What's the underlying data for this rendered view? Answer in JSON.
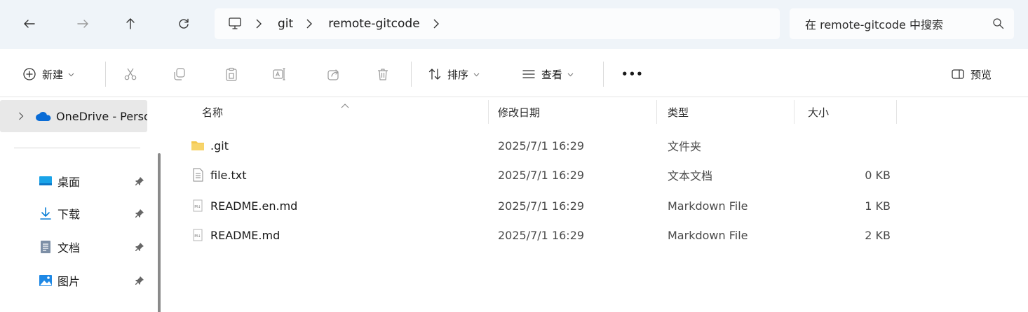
{
  "nav": {
    "back_icon": "arrow-left-icon",
    "forward_icon": "arrow-right-icon",
    "up_icon": "arrow-up-icon",
    "refresh_icon": "refresh-icon"
  },
  "address": {
    "root_icon": "this-pc-icon",
    "crumbs": [
      "git",
      "remote-gitcode"
    ]
  },
  "search": {
    "placeholder": "在 remote-gitcode 中搜索"
  },
  "commands": {
    "new_label": "新建",
    "sort_label": "排序",
    "view_label": "查看",
    "more_label": "•••",
    "preview_label": "预览"
  },
  "sidebar": {
    "onedrive_label": "OneDrive - Personal",
    "quick_access": [
      {
        "label": "桌面",
        "icon": "desktop-icon"
      },
      {
        "label": "下载",
        "icon": "download-icon"
      },
      {
        "label": "文档",
        "icon": "documents-icon"
      },
      {
        "label": "图片",
        "icon": "pictures-icon"
      }
    ]
  },
  "columns": {
    "name": "名称",
    "modified": "修改日期",
    "type": "类型",
    "size": "大小"
  },
  "files": [
    {
      "name": ".git",
      "modified": "2025/7/1 16:29",
      "type": "文件夹",
      "size": "",
      "icon": "folder-icon"
    },
    {
      "name": "file.txt",
      "modified": "2025/7/1 16:29",
      "type": "文本文档",
      "size": "0 KB",
      "icon": "text-file-icon"
    },
    {
      "name": "README.en.md",
      "modified": "2025/7/1 16:29",
      "type": "Markdown File",
      "size": "1 KB",
      "icon": "markdown-file-icon"
    },
    {
      "name": "README.md",
      "modified": "2025/7/1 16:29",
      "type": "Markdown File",
      "size": "2 KB",
      "icon": "markdown-file-icon"
    }
  ],
  "colors": {
    "address_bar_bg": "#eff4f9",
    "accent_blue": "#0a6cd6",
    "folder_yellow": "#f3c74e"
  }
}
